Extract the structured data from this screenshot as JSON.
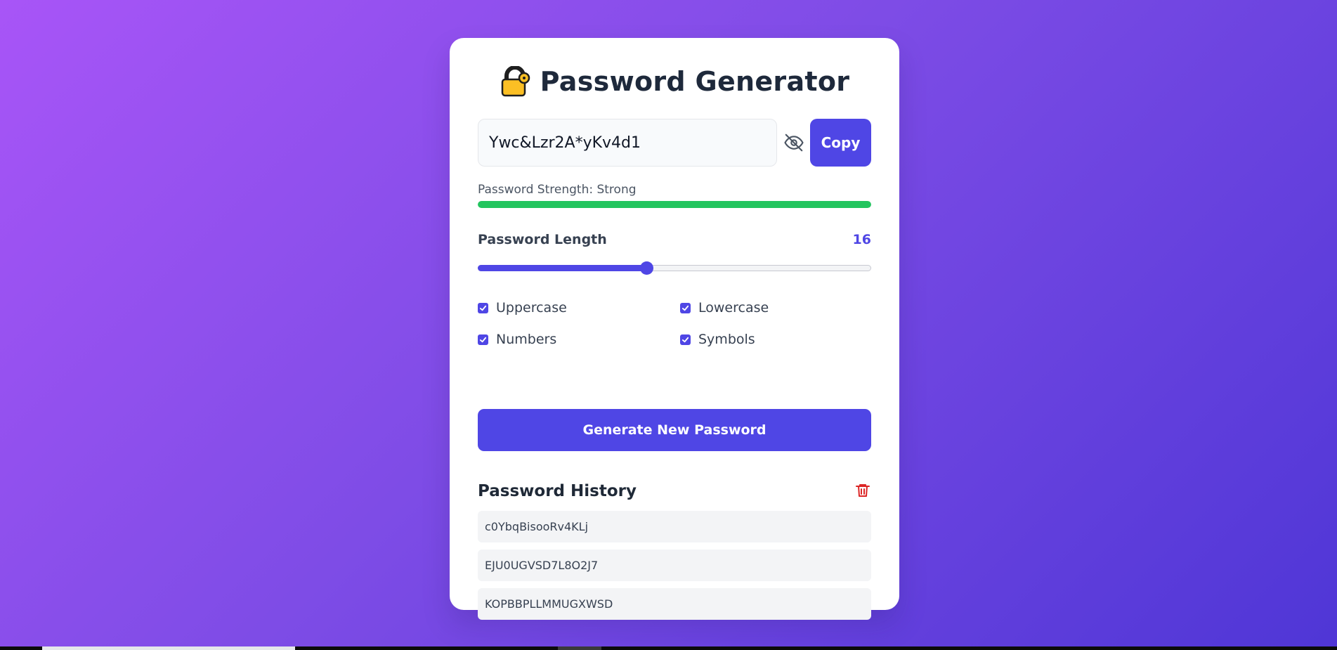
{
  "app": {
    "title": "Password Generator"
  },
  "password": {
    "value": "Ywc&Lzr2A*yKv4d1",
    "copy_label": "Copy"
  },
  "strength": {
    "label": "Password Strength: Strong",
    "level": 1.0,
    "color": "#22c55e"
  },
  "length": {
    "label": "Password Length",
    "value": "16",
    "min": 4,
    "max": 32,
    "current": 16
  },
  "options": [
    {
      "label": "Uppercase",
      "checked": true
    },
    {
      "label": "Lowercase",
      "checked": true
    },
    {
      "label": "Numbers",
      "checked": true
    },
    {
      "label": "Symbols",
      "checked": true
    }
  ],
  "generate_label": "Generate New Password",
  "history": {
    "title": "Password History",
    "items": [
      "c0YbqBisooRv4KLj",
      "EJU0UGVSD7L8O2J7",
      "KOPBBPLLMMUGXWSD"
    ]
  },
  "colors": {
    "accent": "#4f46e5",
    "danger": "#dc2626",
    "background_start": "#a855f7",
    "background_end": "#4f36d6"
  },
  "icons": {
    "title": "lock-icon",
    "visibility": "eye-off-icon",
    "clear_history": "trash-icon",
    "option_checkbox": "check-icon"
  }
}
